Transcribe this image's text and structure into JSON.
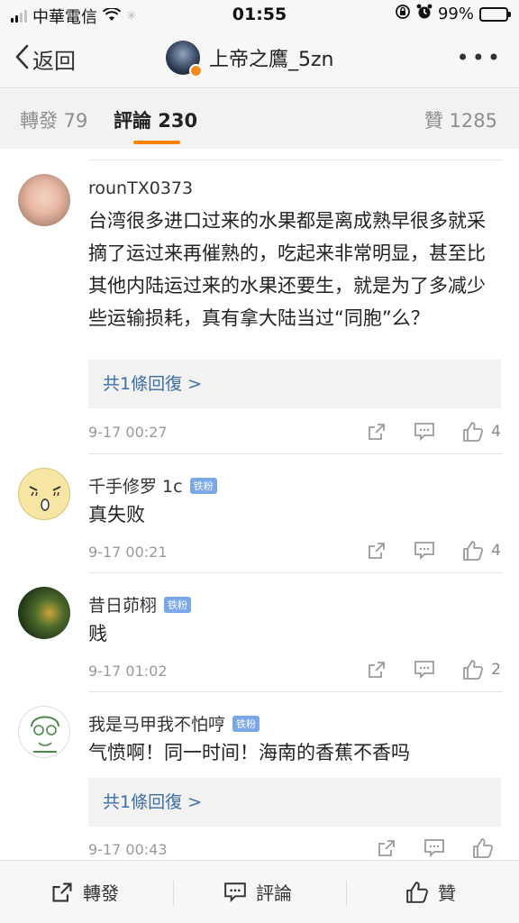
{
  "status_bar": {
    "carrier": "中華電信",
    "time": "01:55",
    "battery": "99%"
  },
  "nav": {
    "back_label": "返回",
    "title": "上帝之鷹_5zn",
    "more": "•••"
  },
  "tabs": {
    "repost": "轉發 79",
    "comments": "評論 230",
    "likes": "贊 1285"
  },
  "comments": [
    {
      "user": "rounTX0373",
      "badge": "",
      "text": "台湾很多进口过来的水果都是离成熟早很多就采摘了运过来再催熟的，吃起来非常明显，甚至比其他内陆运过来的水果还要生，就是为了多减少些运输损耗，真有拿大陆当过“同胞”么？",
      "reply": "共1條回復 >",
      "time": "9-17 00:27",
      "likes": "4"
    },
    {
      "user": "千手修罗 1c",
      "badge": "铁粉",
      "text": "真失败",
      "reply": "",
      "time": "9-17 00:21",
      "likes": "4"
    },
    {
      "user": "昔日茆栩",
      "badge": "铁粉",
      "text": "贱",
      "reply": "",
      "time": "9-17 01:02",
      "likes": "2"
    },
    {
      "user": "我是马甲我不怕哼",
      "badge": "铁粉",
      "text": "气愤啊！同一时间！海南的香蕉不香吗",
      "reply": "共1條回復 >",
      "time": "9-17 00:43",
      "likes": ""
    }
  ],
  "bottom_bar": {
    "repost": "轉發",
    "comment": "評論",
    "like": "贊"
  },
  "colors": {
    "accent": "#ff8200",
    "link": "#3a6ea8",
    "badge": "#7aa7e8",
    "battery": "#4cd964"
  },
  "icons": [
    "signal-icon",
    "wifi-icon",
    "lock-rotation-icon",
    "alarm-icon",
    "battery-icon",
    "back-chevron-icon",
    "more-icon",
    "share-icon",
    "comment-icon",
    "like-icon"
  ]
}
